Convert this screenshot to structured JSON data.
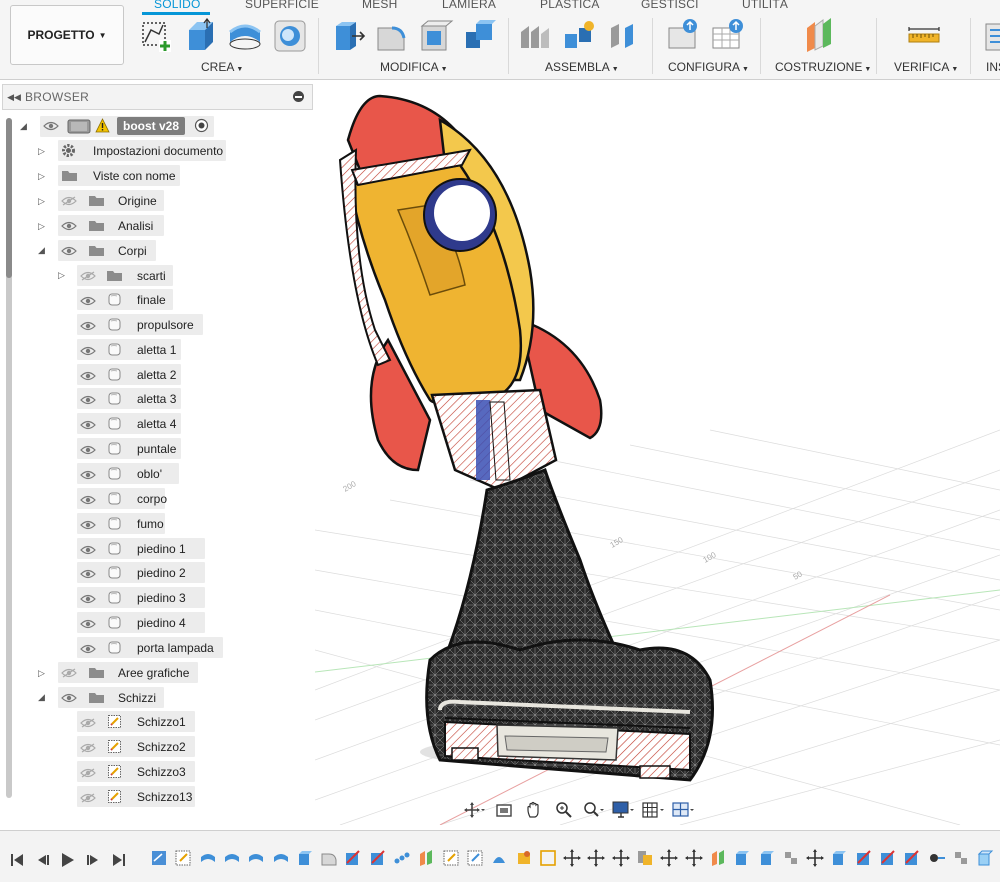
{
  "toolbar": {
    "project_button": "PROGETTO",
    "tabs": [
      "SOLIDO",
      "SUPERFICIE",
      "MESH",
      "LAMIERA",
      "PLASTICA",
      "GESTISCI",
      "UTILITÀ"
    ],
    "groups": [
      "CREA",
      "MODIFICA",
      "ASSEMBLA",
      "CONFIGURA",
      "COSTRUZIONE",
      "VERIFICA",
      "INS"
    ],
    "accent_color": "#0696d7"
  },
  "browser": {
    "title": "BROWSER",
    "root": "boost v28",
    "items": [
      {
        "label": "Impostazioni documento"
      },
      {
        "label": "Viste con nome"
      },
      {
        "label": "Origine"
      },
      {
        "label": "Analisi"
      },
      {
        "label": "Corpi"
      },
      {
        "label": "scarti"
      },
      {
        "label": "finale"
      },
      {
        "label": "propulsore"
      },
      {
        "label": "aletta 1"
      },
      {
        "label": "aletta 2"
      },
      {
        "label": "aletta 3"
      },
      {
        "label": "aletta 4"
      },
      {
        "label": "puntale"
      },
      {
        "label": "oblo'"
      },
      {
        "label": "corpo"
      },
      {
        "label": "fumo"
      },
      {
        "label": "piedino 1"
      },
      {
        "label": "piedino 2"
      },
      {
        "label": "piedino 3"
      },
      {
        "label": "piedino 4"
      },
      {
        "label": "porta lampada"
      },
      {
        "label": "Aree grafiche"
      },
      {
        "label": "Schizzi"
      },
      {
        "label": "Schizzo1"
      },
      {
        "label": "Schizzo2"
      },
      {
        "label": "Schizzo3"
      },
      {
        "label": "Schizzo13"
      }
    ]
  },
  "viewport": {
    "grid_labels": [
      "200",
      "150",
      "100",
      "50"
    ]
  },
  "timeline": {
    "controls": [
      "go-to-start",
      "step-back",
      "play",
      "step-forward",
      "go-to-end"
    ]
  }
}
